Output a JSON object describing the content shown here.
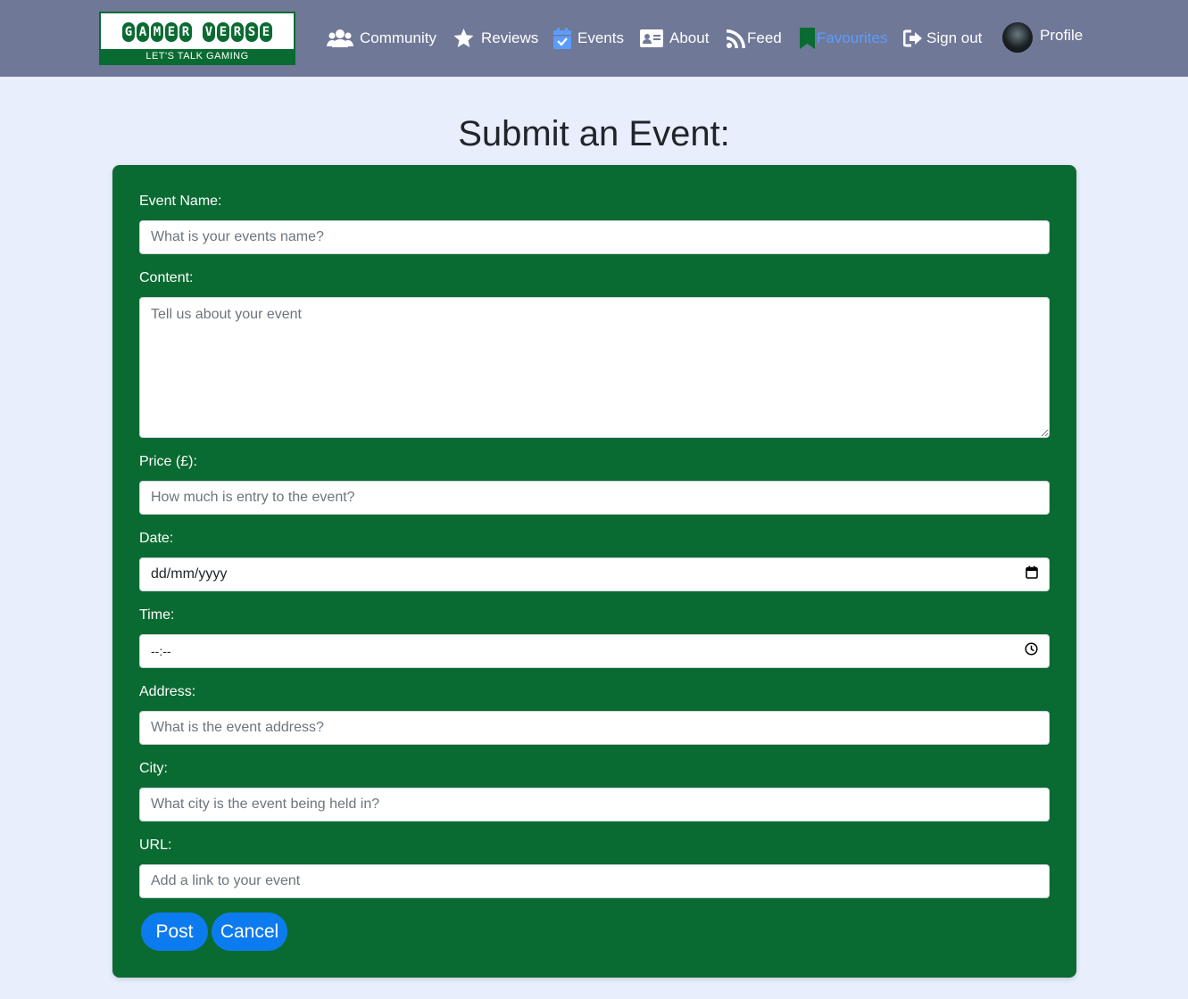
{
  "brand": {
    "logo_letters_left": [
      "G",
      "A",
      "M",
      "E",
      "R"
    ],
    "logo_letters_right": [
      "V",
      "E",
      "R",
      "S",
      "E"
    ],
    "tagline": "LET'S TALK GAMING"
  },
  "nav": {
    "community": "Community",
    "reviews": "Reviews",
    "events": "Events",
    "about": "About",
    "feed": "Feed",
    "favourites": "Favourites",
    "sign_out": "Sign out",
    "profile": "Profile",
    "active_color": "#5b9cff"
  },
  "page": {
    "title": "Submit an Event:"
  },
  "form": {
    "event_name": {
      "label": "Event Name:",
      "placeholder": "What is your events name?"
    },
    "content": {
      "label": "Content:",
      "placeholder": "Tell us about your event"
    },
    "price": {
      "label": "Price (£):",
      "placeholder": "How much is entry to the event?"
    },
    "date": {
      "label": "Date:",
      "value": "dd/mm/yyyy"
    },
    "time": {
      "label": "Time:",
      "value": "--:--"
    },
    "address": {
      "label": "Address:",
      "placeholder": "What is the event address?"
    },
    "city": {
      "label": "City:",
      "placeholder": "What city is the event being held in?"
    },
    "url": {
      "label": "URL:",
      "placeholder": "Add a link to your event"
    },
    "post_label": "Post",
    "cancel_label": "Cancel"
  },
  "colors": {
    "navbar": "#6f7897",
    "card": "#0a6b32",
    "button": "#0d7bf0",
    "page_bg": "#e8eefc"
  }
}
